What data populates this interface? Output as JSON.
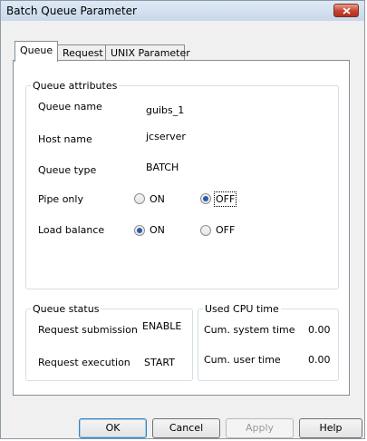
{
  "window": {
    "title": "Batch Queue Parameter"
  },
  "tabs": [
    {
      "label": "Queue"
    },
    {
      "label": "Request"
    },
    {
      "label": "UNIX Parameter"
    }
  ],
  "queue_attributes": {
    "title": "Queue attributes",
    "queue_name_label": "Queue name",
    "queue_name_value": "guibs_1",
    "host_name_label": "Host name",
    "host_name_value": "jcserver",
    "queue_type_label": "Queue type",
    "queue_type_value": "BATCH",
    "pipe_only": {
      "label": "Pipe only",
      "on_label": "ON",
      "off_label": "OFF",
      "selected": "OFF"
    },
    "load_balance": {
      "label": "Load balance",
      "on_label": "ON",
      "off_label": "OFF",
      "selected": "ON"
    }
  },
  "queue_status": {
    "title": "Queue status",
    "submission_label": "Request submission",
    "submission_value": "ENABLE",
    "execution_label": "Request execution",
    "execution_value": "START"
  },
  "cpu_time": {
    "title": "Used CPU time",
    "system_label": "Cum. system time",
    "system_value": "0.00",
    "user_label": "Cum. user time",
    "user_value": "0.00"
  },
  "buttons": {
    "ok": "OK",
    "cancel": "Cancel",
    "apply": "Apply",
    "help": "Help"
  }
}
